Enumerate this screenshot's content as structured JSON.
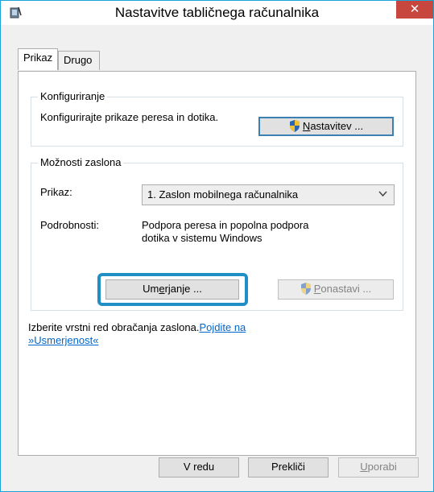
{
  "window": {
    "title": "Nastavitve tabličnega računalnika",
    "close_glyph": "✕"
  },
  "tabs": [
    {
      "label": "Prikaz",
      "selected": true
    },
    {
      "label": "Drugo",
      "selected": false
    }
  ],
  "configure": {
    "group_title": "Konfiguriranje",
    "description": "Konfigurirajte prikaze peresa in dotika.",
    "setup_button_pre": "",
    "setup_button_mnemonic": "N",
    "setup_button_post": "astavitev ..."
  },
  "display_options": {
    "group_title": "Možnosti zaslona",
    "display_label": "Prikaz:",
    "display_value": "1. Zaslon mobilnega računalnika",
    "details_label": "Podrobnosti:",
    "details_value_line1": "Podpora peresa in popolna podpora",
    "details_value_line2": "dotika v sistemu Windows",
    "calibrate_pre": "Um",
    "calibrate_mnemonic": "e",
    "calibrate_post": "rjanje ...",
    "reset_mnemonic": "P",
    "reset_post": "onastavi ..."
  },
  "orientation": {
    "text": "Izberite vrstni red obračanja zaslona.",
    "link_line1": "Pojdite na",
    "link_line2": "»Usmerjenost«"
  },
  "footer": {
    "ok_label": "V redu",
    "cancel_label": "Prekliči",
    "apply_mnemonic": "U",
    "apply_post": "porabi"
  },
  "colors": {
    "accent": "#1aa3d6",
    "close": "#c7463e",
    "highlight": "#1f8fc6",
    "link": "#0066cc"
  }
}
